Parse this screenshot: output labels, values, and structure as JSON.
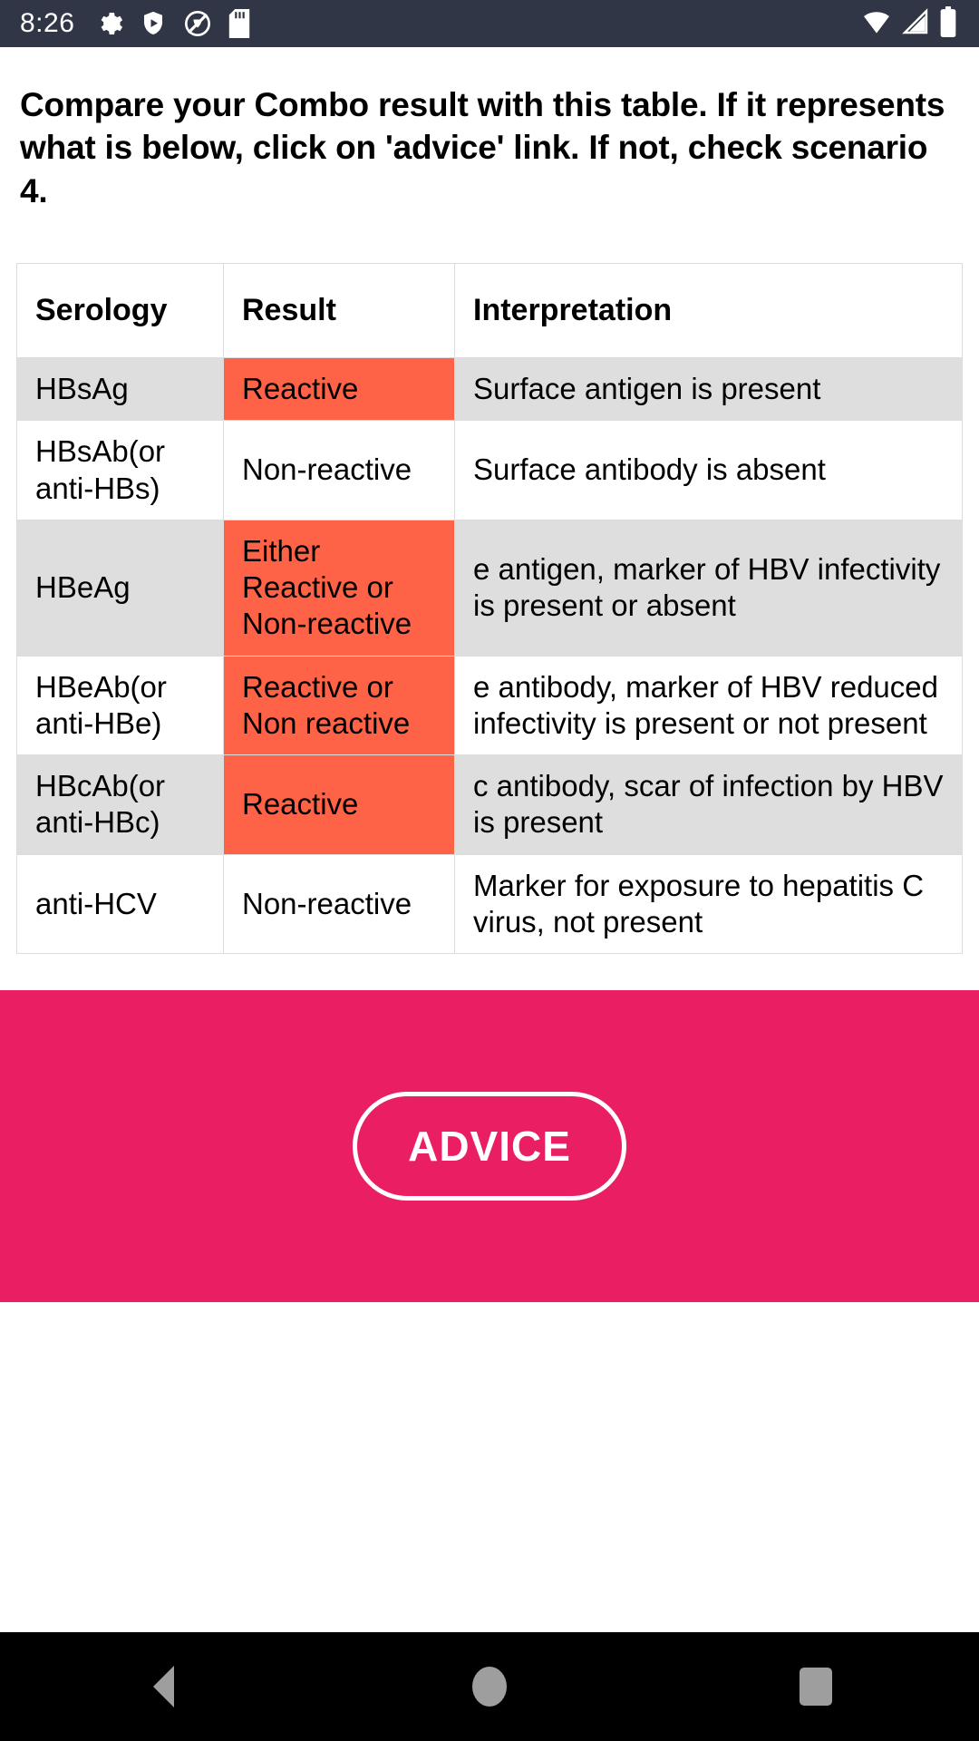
{
  "status_bar": {
    "time": "8:26",
    "left_icons": [
      "gear-icon",
      "play-protect-shield-icon",
      "do-not-disturb-icon",
      "sd-card-icon"
    ],
    "right_icons": [
      "wifi-icon",
      "cellular-signal-icon",
      "battery-icon"
    ],
    "background_color": "#303645"
  },
  "headline": "Compare your Combo result with this table. If it represents what is below, click on 'advice' link. If not, check scenario 4.",
  "table": {
    "headers": [
      "Serology",
      "Result",
      "Interpretation"
    ],
    "rows": [
      {
        "serology": "HBsAg",
        "result": "Reactive",
        "interpretation": "Surface antigen is present",
        "highlight": true,
        "shaded": true
      },
      {
        "serology": "HBsAb(or anti-HBs)",
        "result": "Non-reactive",
        "interpretation": "Surface antibody is absent",
        "highlight": false,
        "shaded": false
      },
      {
        "serology": "HBeAg",
        "result": "Either Reactive or Non-reactive",
        "interpretation": "e antigen, marker of HBV infectivity is present or absent",
        "highlight": true,
        "shaded": true
      },
      {
        "serology": "HBeAb(or anti-HBe)",
        "result": "Reactive or Non reactive",
        "interpretation": "e antibody, marker of HBV reduced infectivity is present or not present",
        "highlight": true,
        "shaded": false
      },
      {
        "serology": "HBcAb(or anti-HBc)",
        "result": "Reactive",
        "interpretation": "c antibody, scar of infection by HBV is present",
        "highlight": true,
        "shaded": true
      },
      {
        "serology": "anti-HCV",
        "result": "Non-reactive",
        "interpretation": "Marker for exposure to hepatitis C virus, not present",
        "highlight": false,
        "shaded": false
      }
    ],
    "highlight_color": "#ff6347",
    "shade_color": "#dedede",
    "border_color": "#dcdcdc"
  },
  "advice": {
    "label": "ADVICE",
    "band_color": "#e91e63",
    "text_color": "#ffffff"
  },
  "nav_bar": {
    "background_color": "#000000",
    "buttons": [
      "back-button",
      "home-button",
      "recents-button"
    ]
  }
}
